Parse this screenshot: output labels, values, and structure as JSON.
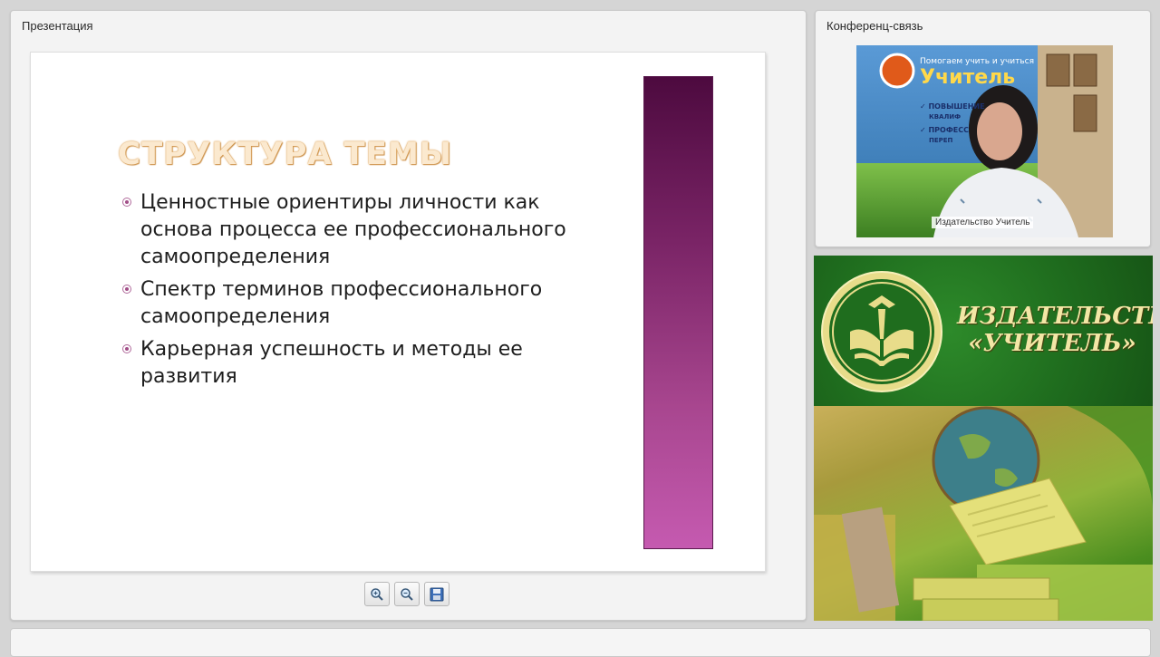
{
  "presentation": {
    "title": "Презентация",
    "slide": {
      "title": "СТРУКТУРА ТЕМЫ",
      "bullets": [
        "Ценностные ориентиры личности как основа процесса ее профессионального самоопределения",
        "Спектр терминов профессионального самоопределения",
        "Карьерная успешность и методы ее развития"
      ],
      "bar_gradient": [
        "#4d0a3f",
        "#c55ab0"
      ]
    },
    "toolbar": {
      "buttons": [
        "zoom-in-icon",
        "zoom-out-icon",
        "save-icon"
      ]
    }
  },
  "conference": {
    "title": "Конференц-связь",
    "video_caption": "Издательство Учитель",
    "banner_lines": [
      "Помогаем учить и учиться",
      "Учитель",
      "ПОВЫШЕНИЕ",
      "КВАЛИФ",
      "ПРОФЕСС",
      "ПЕРЕП"
    ]
  },
  "brand": {
    "name_line1": "ИЗДАТЕЛЬСТВО",
    "name_line2": "«УЧИТЕЛЬ»",
    "colors": {
      "green": "#1f6d1e",
      "gold": "#f3e7a6"
    }
  }
}
